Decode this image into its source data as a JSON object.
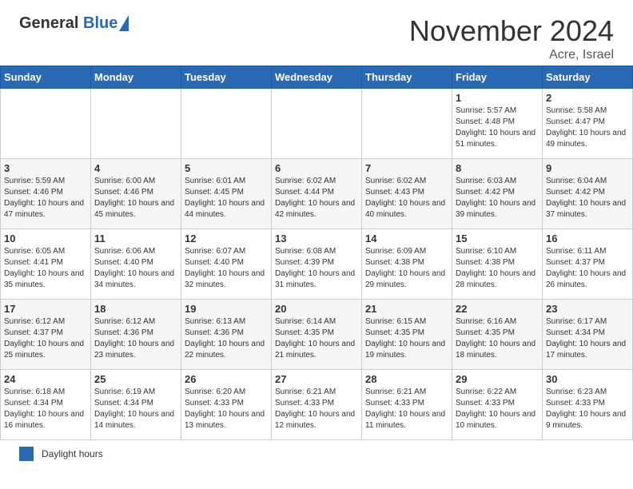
{
  "header": {
    "logo_line1": "General",
    "logo_line2": "Blue",
    "month": "November 2024",
    "location": "Acre, Israel"
  },
  "weekdays": [
    "Sunday",
    "Monday",
    "Tuesday",
    "Wednesday",
    "Thursday",
    "Friday",
    "Saturday"
  ],
  "weeks": [
    [
      {
        "day": "",
        "info": ""
      },
      {
        "day": "",
        "info": ""
      },
      {
        "day": "",
        "info": ""
      },
      {
        "day": "",
        "info": ""
      },
      {
        "day": "",
        "info": ""
      },
      {
        "day": "1",
        "info": "Sunrise: 5:57 AM\nSunset: 4:48 PM\nDaylight: 10 hours and 51 minutes."
      },
      {
        "day": "2",
        "info": "Sunrise: 5:58 AM\nSunset: 4:47 PM\nDaylight: 10 hours and 49 minutes."
      }
    ],
    [
      {
        "day": "3",
        "info": "Sunrise: 5:59 AM\nSunset: 4:46 PM\nDaylight: 10 hours and 47 minutes."
      },
      {
        "day": "4",
        "info": "Sunrise: 6:00 AM\nSunset: 4:46 PM\nDaylight: 10 hours and 45 minutes."
      },
      {
        "day": "5",
        "info": "Sunrise: 6:01 AM\nSunset: 4:45 PM\nDaylight: 10 hours and 44 minutes."
      },
      {
        "day": "6",
        "info": "Sunrise: 6:02 AM\nSunset: 4:44 PM\nDaylight: 10 hours and 42 minutes."
      },
      {
        "day": "7",
        "info": "Sunrise: 6:02 AM\nSunset: 4:43 PM\nDaylight: 10 hours and 40 minutes."
      },
      {
        "day": "8",
        "info": "Sunrise: 6:03 AM\nSunset: 4:42 PM\nDaylight: 10 hours and 39 minutes."
      },
      {
        "day": "9",
        "info": "Sunrise: 6:04 AM\nSunset: 4:42 PM\nDaylight: 10 hours and 37 minutes."
      }
    ],
    [
      {
        "day": "10",
        "info": "Sunrise: 6:05 AM\nSunset: 4:41 PM\nDaylight: 10 hours and 35 minutes."
      },
      {
        "day": "11",
        "info": "Sunrise: 6:06 AM\nSunset: 4:40 PM\nDaylight: 10 hours and 34 minutes."
      },
      {
        "day": "12",
        "info": "Sunrise: 6:07 AM\nSunset: 4:40 PM\nDaylight: 10 hours and 32 minutes."
      },
      {
        "day": "13",
        "info": "Sunrise: 6:08 AM\nSunset: 4:39 PM\nDaylight: 10 hours and 31 minutes."
      },
      {
        "day": "14",
        "info": "Sunrise: 6:09 AM\nSunset: 4:38 PM\nDaylight: 10 hours and 29 minutes."
      },
      {
        "day": "15",
        "info": "Sunrise: 6:10 AM\nSunset: 4:38 PM\nDaylight: 10 hours and 28 minutes."
      },
      {
        "day": "16",
        "info": "Sunrise: 6:11 AM\nSunset: 4:37 PM\nDaylight: 10 hours and 26 minutes."
      }
    ],
    [
      {
        "day": "17",
        "info": "Sunrise: 6:12 AM\nSunset: 4:37 PM\nDaylight: 10 hours and 25 minutes."
      },
      {
        "day": "18",
        "info": "Sunrise: 6:12 AM\nSunset: 4:36 PM\nDaylight: 10 hours and 23 minutes."
      },
      {
        "day": "19",
        "info": "Sunrise: 6:13 AM\nSunset: 4:36 PM\nDaylight: 10 hours and 22 minutes."
      },
      {
        "day": "20",
        "info": "Sunrise: 6:14 AM\nSunset: 4:35 PM\nDaylight: 10 hours and 21 minutes."
      },
      {
        "day": "21",
        "info": "Sunrise: 6:15 AM\nSunset: 4:35 PM\nDaylight: 10 hours and 19 minutes."
      },
      {
        "day": "22",
        "info": "Sunrise: 6:16 AM\nSunset: 4:35 PM\nDaylight: 10 hours and 18 minutes."
      },
      {
        "day": "23",
        "info": "Sunrise: 6:17 AM\nSunset: 4:34 PM\nDaylight: 10 hours and 17 minutes."
      }
    ],
    [
      {
        "day": "24",
        "info": "Sunrise: 6:18 AM\nSunset: 4:34 PM\nDaylight: 10 hours and 16 minutes."
      },
      {
        "day": "25",
        "info": "Sunrise: 6:19 AM\nSunset: 4:34 PM\nDaylight: 10 hours and 14 minutes."
      },
      {
        "day": "26",
        "info": "Sunrise: 6:20 AM\nSunset: 4:33 PM\nDaylight: 10 hours and 13 minutes."
      },
      {
        "day": "27",
        "info": "Sunrise: 6:21 AM\nSunset: 4:33 PM\nDaylight: 10 hours and 12 minutes."
      },
      {
        "day": "28",
        "info": "Sunrise: 6:21 AM\nSunset: 4:33 PM\nDaylight: 10 hours and 11 minutes."
      },
      {
        "day": "29",
        "info": "Sunrise: 6:22 AM\nSunset: 4:33 PM\nDaylight: 10 hours and 10 minutes."
      },
      {
        "day": "30",
        "info": "Sunrise: 6:23 AM\nSunset: 4:33 PM\nDaylight: 10 hours and 9 minutes."
      }
    ]
  ],
  "footer": {
    "legend_label": "Daylight hours"
  }
}
